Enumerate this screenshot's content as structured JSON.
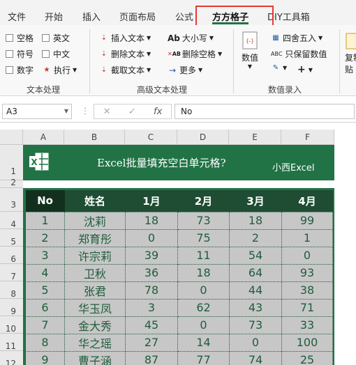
{
  "ribbon_tabs": [
    "文件",
    "开始",
    "插入",
    "页面布局",
    "公式",
    "方方格子",
    "DIY工具箱"
  ],
  "active_tab": "方方格子",
  "ribbon": {
    "text_group": {
      "label": "文本处理",
      "options": [
        "空格",
        "英文",
        "符号",
        "中文",
        "数字"
      ],
      "execute": "执行"
    },
    "advanced_group": {
      "label": "高级文本处理",
      "insert_text": "插入文本",
      "delete_text": "删除文本",
      "extract_text": "截取文本",
      "case": "大小写",
      "delete_spaces": "删除空格",
      "more": "更多",
      "case_icon": "Ab",
      "spaces_icon": "AB"
    },
    "number_group": {
      "label": "数值录入",
      "number": "数值",
      "round": "四舍五入",
      "keep_values": "只保留数值",
      "keep_values_icon": "ABC",
      "plus": "+",
      "partial_right": "复制",
      "partial_right2": "贴"
    }
  },
  "formula_bar": {
    "name_box": "A3",
    "fx": "fx",
    "content": "No"
  },
  "columns": [
    "A",
    "B",
    "C",
    "D",
    "E",
    "F"
  ],
  "rows": [
    "1",
    "2",
    "3",
    "4",
    "5",
    "6",
    "7",
    "8",
    "9",
    "10",
    "11",
    "12"
  ],
  "banner": {
    "title": "Excel批量填充空白单元格?",
    "subtitle": "小西Excel"
  },
  "table": {
    "headers": [
      "No",
      "姓名",
      "1月",
      "2月",
      "3月",
      "4月"
    ],
    "rows": [
      [
        "1",
        "沈莉",
        "18",
        "73",
        "18",
        "99"
      ],
      [
        "2",
        "郑育彤",
        "0",
        "75",
        "2",
        "1"
      ],
      [
        "3",
        "许宗莉",
        "39",
        "11",
        "54",
        "0"
      ],
      [
        "4",
        "卫秋",
        "36",
        "18",
        "64",
        "93"
      ],
      [
        "5",
        "张君",
        "78",
        "0",
        "44",
        "38"
      ],
      [
        "6",
        "华玉凤",
        "3",
        "62",
        "43",
        "71"
      ],
      [
        "7",
        "金大秀",
        "45",
        "0",
        "73",
        "33"
      ],
      [
        "8",
        "华之瑶",
        "27",
        "14",
        "0",
        "100"
      ],
      [
        "9",
        "曹子涵",
        "87",
        "77",
        "74",
        "25"
      ]
    ]
  },
  "colors": {
    "accent": "#217346",
    "header_dark": "#1e4d33",
    "cell_bg": "#c7c7c7",
    "highlight": "#e53935"
  }
}
